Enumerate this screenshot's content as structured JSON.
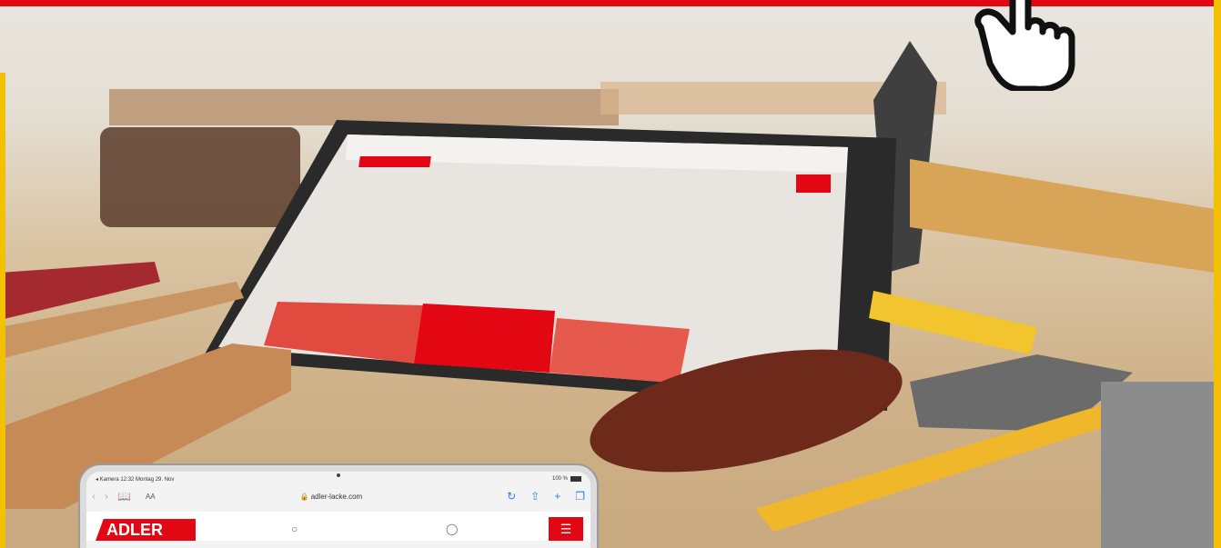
{
  "browser": {
    "status_left": "◂ Kamera  12:32  Montag 29. Nov",
    "status_right": "100 %",
    "back_icon": "chevron-left-icon",
    "forward_icon": "chevron-right-icon",
    "reader_icon": "book-icon",
    "text_size_label": "AA",
    "address": "adler-lacke.com",
    "lock_icon": "lock-icon",
    "reload_icon": "reload-icon",
    "share_icon": "share-icon",
    "add_icon": "plus-icon",
    "tabs_icon": "tabs-icon"
  },
  "site": {
    "logo_text": "ADLER",
    "search_icon": "search-icon",
    "account_icon": "user-icon",
    "menu_icon": "hamburger-menu-icon"
  },
  "overlay": {
    "pointer_icon": "hand-pointer-icon"
  },
  "colors": {
    "brand_red": "#e30613",
    "frame_yellow": "#f2c200",
    "link_blue": "#2f7df6"
  }
}
